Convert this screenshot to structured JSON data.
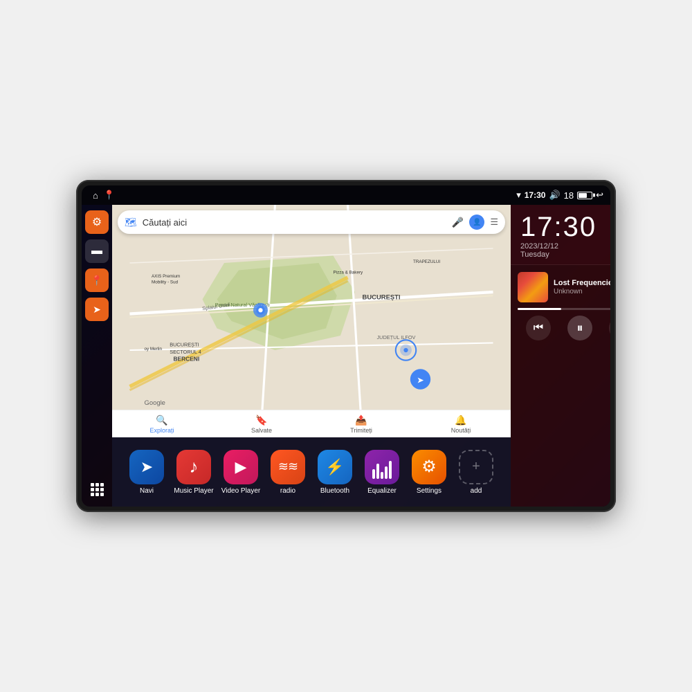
{
  "device": {
    "status_bar": {
      "wifi_icon": "▾",
      "time": "17:30",
      "volume_icon": "🔊",
      "signal": "18",
      "back_icon": "↩"
    },
    "sidebar": {
      "buttons": [
        {
          "id": "settings",
          "icon": "⚙",
          "style": "orange"
        },
        {
          "id": "files",
          "icon": "▬",
          "style": "gray"
        },
        {
          "id": "maps",
          "icon": "📍",
          "style": "orange"
        },
        {
          "id": "navigate",
          "icon": "➤",
          "style": "orange"
        }
      ]
    },
    "map": {
      "search_placeholder": "Căutați aici",
      "places": [
        "AXIS Premium Mobility - Sud",
        "Pizza & Bakery",
        "Parcul Natural Văcărești",
        "BUCUREȘTI SECTORUL 4",
        "BUCUREȘTI",
        "JUDEȚUL ILFOV",
        "BERCENI",
        "oy Merlin"
      ],
      "bottom_tabs": [
        {
          "label": "Explorați",
          "icon": "🔍",
          "active": true
        },
        {
          "label": "Salvate",
          "icon": "🔖",
          "active": false
        },
        {
          "label": "Trimiteți",
          "icon": "📤",
          "active": false
        },
        {
          "label": "Noutăți",
          "icon": "🔔",
          "active": false
        }
      ]
    },
    "clock": {
      "time": "17:30",
      "date": "2023/12/12",
      "day": "Tuesday"
    },
    "music": {
      "title": "Lost Frequencies_Janie...",
      "artist": "Unknown",
      "progress": 35
    },
    "apps": [
      {
        "id": "navi",
        "label": "Navi",
        "icon": "➤",
        "color": "blue-dark"
      },
      {
        "id": "music-player",
        "label": "Music Player",
        "icon": "♪",
        "color": "red"
      },
      {
        "id": "video-player",
        "label": "Video Player",
        "icon": "▶",
        "color": "pink"
      },
      {
        "id": "radio",
        "label": "radio",
        "icon": "≋",
        "color": "orange-red"
      },
      {
        "id": "bluetooth",
        "label": "Bluetooth",
        "icon": "⚡",
        "color": "blue"
      },
      {
        "id": "equalizer",
        "label": "Equalizer",
        "icon": "≡",
        "color": "purple"
      },
      {
        "id": "settings",
        "label": "Settings",
        "icon": "⚙",
        "color": "orange"
      },
      {
        "id": "add",
        "label": "add",
        "icon": "+",
        "color": "outline"
      }
    ]
  }
}
